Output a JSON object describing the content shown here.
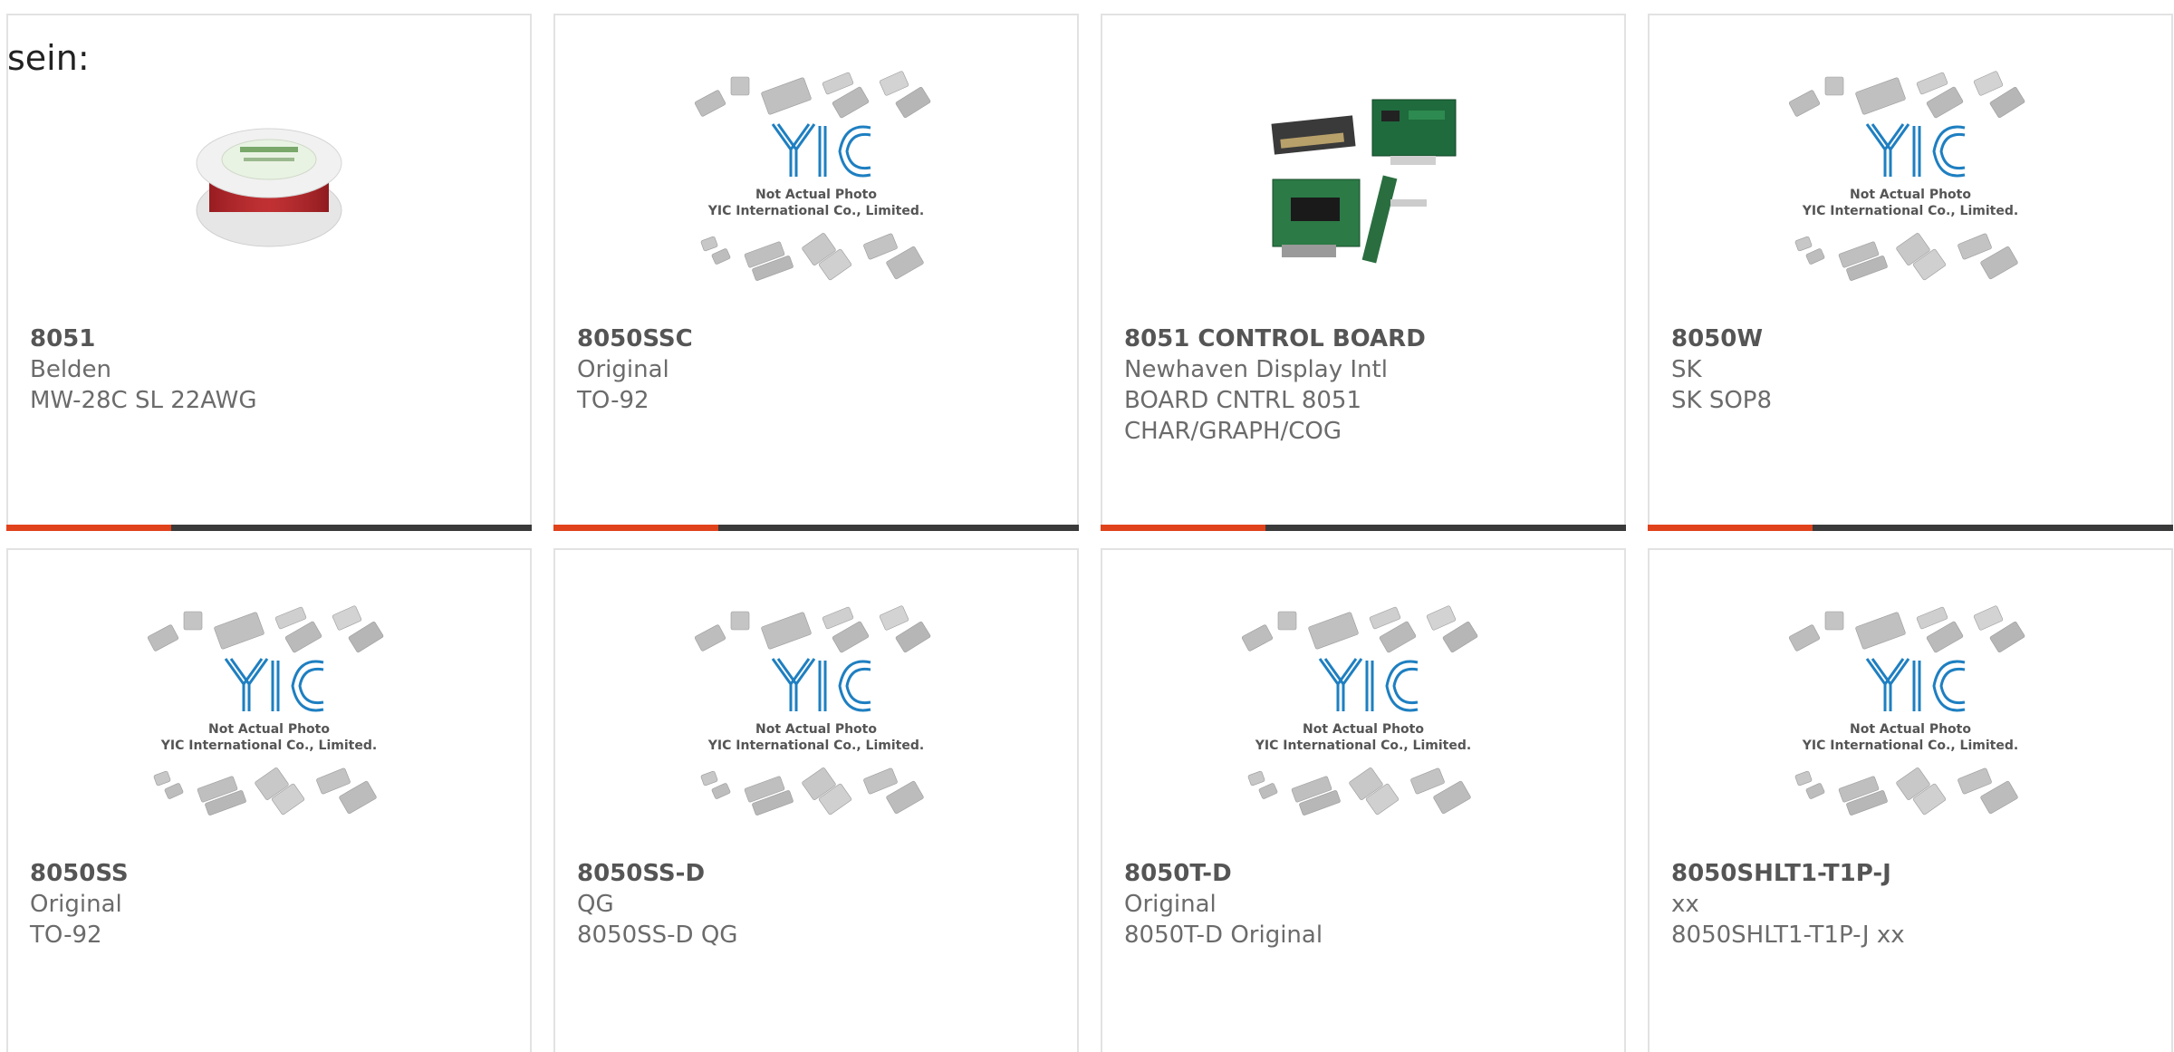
{
  "intro_text": "sein:",
  "products": [
    {
      "part": "8051",
      "line1": "Belden",
      "line2": "MW-28C SL 22AWG",
      "line3": "",
      "image": "wire-spool"
    },
    {
      "part": "8050SSC",
      "line1": "Original",
      "line2": "TO-92",
      "line3": "",
      "image": "placeholder"
    },
    {
      "part": "8051 CONTROL BOARD",
      "line1": "Newhaven Display Intl",
      "line2": "BOARD CNTRL 8051",
      "line3": "CHAR/GRAPH/COG",
      "image": "control-board"
    },
    {
      "part": "8050W",
      "line1": "SK",
      "line2": "SK SOP8",
      "line3": "",
      "image": "placeholder"
    },
    {
      "part": "8050SS",
      "line1": "Original",
      "line2": "TO-92",
      "line3": "",
      "image": "placeholder"
    },
    {
      "part": "8050SS-D",
      "line1": "QG",
      "line2": "8050SS-D QG",
      "line3": "",
      "image": "placeholder"
    },
    {
      "part": "8050T-D",
      "line1": "Original",
      "line2": "8050T-D Original",
      "line3": "",
      "image": "placeholder"
    },
    {
      "part": "8050SHLT1-T1P-J",
      "line1": "xx",
      "line2": "8050SHLT1-T1P-J xx",
      "line3": "",
      "image": "placeholder"
    }
  ],
  "placeholder": {
    "logo_text": "YIC",
    "caption_line1": "Not Actual Photo",
    "caption_line2": "YIC International Co., Limited."
  },
  "colors": {
    "accent": "#e0421c",
    "bar": "#3a3a3a",
    "logo_blue": "#1e7fc1",
    "chip_gray": "#b5b5b5"
  }
}
